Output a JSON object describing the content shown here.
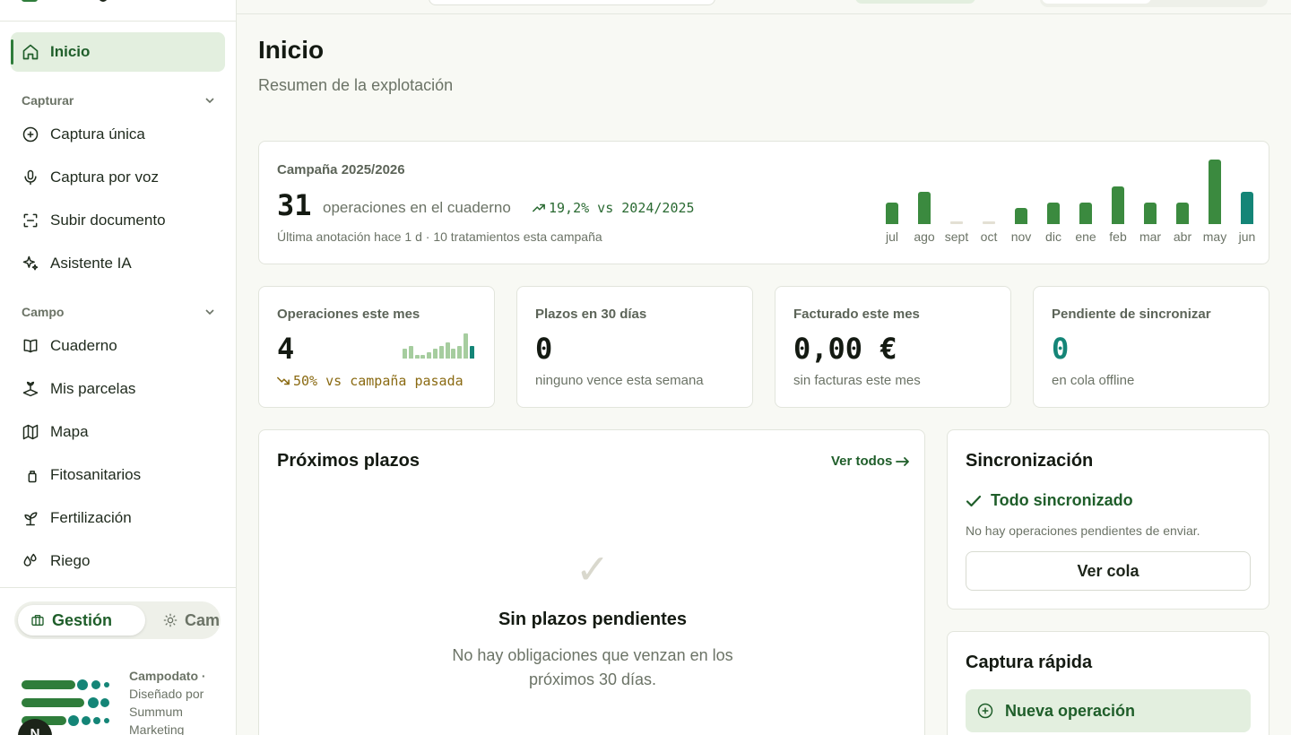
{
  "sidebar": {
    "home": "Inicio",
    "section_capture": "Capturar",
    "capture_items": [
      "Captura única",
      "Captura por voz",
      "Subir documento",
      "Asistente IA"
    ],
    "section_field": "Campo",
    "field_items": [
      "Cuaderno",
      "Mis parcelas",
      "Mapa",
      "Fitosanitarios",
      "Fertilización",
      "Riego"
    ],
    "mode_management": "Gestión",
    "mode_field": "Campo",
    "brand_name": "Campodato ·",
    "brand_credit": "Diseñado por Summum Marketing",
    "avatar_initial": "N"
  },
  "page": {
    "title": "Inicio",
    "subtitle": "Resumen de la explotación"
  },
  "campaign": {
    "label": "Campaña 2025/2026",
    "count": "31",
    "count_label": "operaciones en el cuaderno",
    "trend": "19,2% vs 2024/2025",
    "meta": "Última anotación hace 1 d · 10 tratamientos esta campaña"
  },
  "chart_data": {
    "type": "bar",
    "categories": [
      "jul",
      "ago",
      "sept",
      "oct",
      "nov",
      "dic",
      "ene",
      "feb",
      "mar",
      "abr",
      "may",
      "jun"
    ],
    "values": [
      2,
      3,
      0,
      0,
      1.5,
      2,
      2,
      3.5,
      2,
      2,
      6,
      3
    ],
    "current_index": 11,
    "ylim": [
      0,
      6
    ],
    "colors": {
      "bar": "#3b8a3f",
      "current": "#148577",
      "zero": "#e3e0d4"
    }
  },
  "stats": {
    "ops_month": {
      "label": "Operaciones este mes",
      "value": "4",
      "trend": "50% vs campaña pasada"
    },
    "deadlines_30": {
      "label": "Plazos en 30 días",
      "value": "0",
      "note": "ninguno vence esta semana"
    },
    "billed_month": {
      "label": "Facturado este mes",
      "value": "0,00 €",
      "note": "sin facturas este mes"
    },
    "pending_sync": {
      "label": "Pendiente de sincronizar",
      "value": "0",
      "note": "en cola offline"
    }
  },
  "mini_chart": {
    "values": [
      3,
      4,
      1,
      1,
      2,
      3,
      4,
      5,
      3,
      4,
      8,
      4
    ],
    "ylim": [
      0,
      8
    ]
  },
  "deadlines": {
    "title": "Próximos plazos",
    "view_all": "Ver todos",
    "empty_icon": "✓",
    "empty_title": "Sin plazos pendientes",
    "empty_desc": "No hay obligaciones que venzan en los próximos 30 días."
  },
  "sync": {
    "title": "Sincronización",
    "status": "Todo sincronizado",
    "note": "No hay operaciones pendientes de enviar.",
    "button": "Ver cola"
  },
  "quick": {
    "title": "Captura rápida",
    "button": "Nueva operación"
  }
}
